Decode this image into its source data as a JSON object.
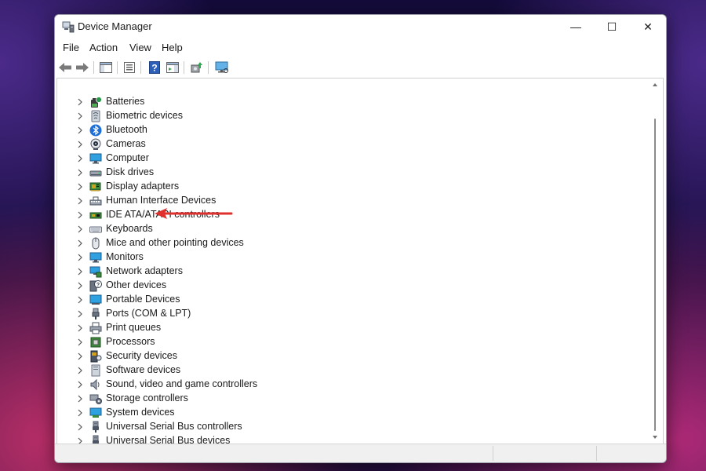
{
  "window": {
    "title": "Device Manager"
  },
  "caption": {
    "minimize": "—",
    "maximize": "☐",
    "close": "✕"
  },
  "menu": {
    "items": [
      {
        "label": "File"
      },
      {
        "label": "Action"
      },
      {
        "label": "View"
      },
      {
        "label": "Help"
      }
    ]
  },
  "toolbar": {
    "buttons": [
      {
        "icon": "back-arrow-icon"
      },
      {
        "icon": "forward-arrow-icon"
      },
      {
        "icon": "show-hide-console-tree-icon"
      },
      {
        "icon": "properties-icon"
      },
      {
        "icon": "help-icon"
      },
      {
        "icon": "action-pane-icon"
      },
      {
        "icon": "update-driver-icon"
      },
      {
        "icon": "scan-hardware-monitor-icon"
      }
    ]
  },
  "tree": {
    "items": [
      {
        "label": "Batteries",
        "icon": "battery-icon"
      },
      {
        "label": "Biometric devices",
        "icon": "biometric-icon"
      },
      {
        "label": "Bluetooth",
        "icon": "bluetooth-icon"
      },
      {
        "label": "Cameras",
        "icon": "camera-icon"
      },
      {
        "label": "Computer",
        "icon": "computer-icon"
      },
      {
        "label": "Disk drives",
        "icon": "disk-drive-icon"
      },
      {
        "label": "Display adapters",
        "icon": "display-adapter-icon"
      },
      {
        "label": "Human Interface Devices",
        "icon": "hid-icon"
      },
      {
        "label": "IDE ATA/ATAPI controllers",
        "icon": "ide-controller-icon"
      },
      {
        "label": "Keyboards",
        "icon": "keyboard-icon"
      },
      {
        "label": "Mice and other pointing devices",
        "icon": "mouse-icon"
      },
      {
        "label": "Monitors",
        "icon": "monitor-icon"
      },
      {
        "label": "Network adapters",
        "icon": "network-adapter-icon"
      },
      {
        "label": "Other devices",
        "icon": "other-devices-icon"
      },
      {
        "label": "Portable Devices",
        "icon": "portable-device-icon"
      },
      {
        "label": "Ports (COM & LPT)",
        "icon": "port-icon"
      },
      {
        "label": "Print queues",
        "icon": "printer-icon"
      },
      {
        "label": "Processors",
        "icon": "processor-icon"
      },
      {
        "label": "Security devices",
        "icon": "security-device-icon"
      },
      {
        "label": "Software devices",
        "icon": "software-device-icon"
      },
      {
        "label": "Sound, video and game controllers",
        "icon": "speaker-icon"
      },
      {
        "label": "Storage controllers",
        "icon": "storage-controller-icon"
      },
      {
        "label": "System devices",
        "icon": "system-device-icon"
      },
      {
        "label": "Universal Serial Bus controllers",
        "icon": "usb-icon"
      },
      {
        "label": "Universal Serial Bus devices",
        "icon": "usb-icon"
      }
    ]
  },
  "colors": {
    "annotation_arrow": "#e0302e",
    "accent_blue": "#2a6fd6"
  }
}
